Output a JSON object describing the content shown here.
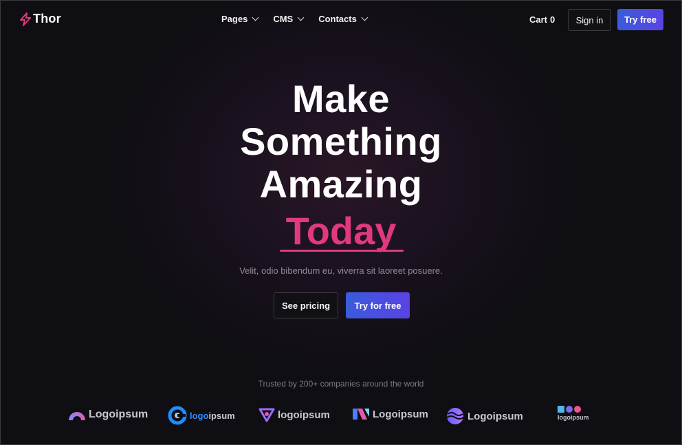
{
  "brand": {
    "name": "Thor",
    "accent": "#e0397f",
    "primary": "#4a52e0"
  },
  "nav": {
    "items": [
      {
        "label": "Pages"
      },
      {
        "label": "CMS"
      },
      {
        "label": "Contacts"
      }
    ],
    "cart_label": "Cart",
    "cart_count": "0",
    "signin_label": "Sign in",
    "tryfree_label": "Try free"
  },
  "hero": {
    "title_lines": [
      "Make",
      "Something",
      "Amazing"
    ],
    "highlight": "Today",
    "subtitle": "Velit, odio bibendum eu, viverra sit laoreet posuere.",
    "secondary_cta": "See pricing",
    "primary_cta": "Try for free"
  },
  "trusted": {
    "text": "Trusted by 200+ companies around the world",
    "logos": [
      {
        "text": "Logoipsum",
        "icon": "arch-icon"
      },
      {
        "text_a": "logo",
        "text_b": "ipsum",
        "icon": "ring-icon"
      },
      {
        "text": "logoipsum",
        "icon": "triangle-icon"
      },
      {
        "text": "Logoipsum",
        "icon": "n-stripes-icon"
      },
      {
        "text": "Logoipsum",
        "icon": "wave-sphere-icon"
      },
      {
        "text": "logoipsum",
        "icon": "shapes-icon"
      }
    ]
  }
}
